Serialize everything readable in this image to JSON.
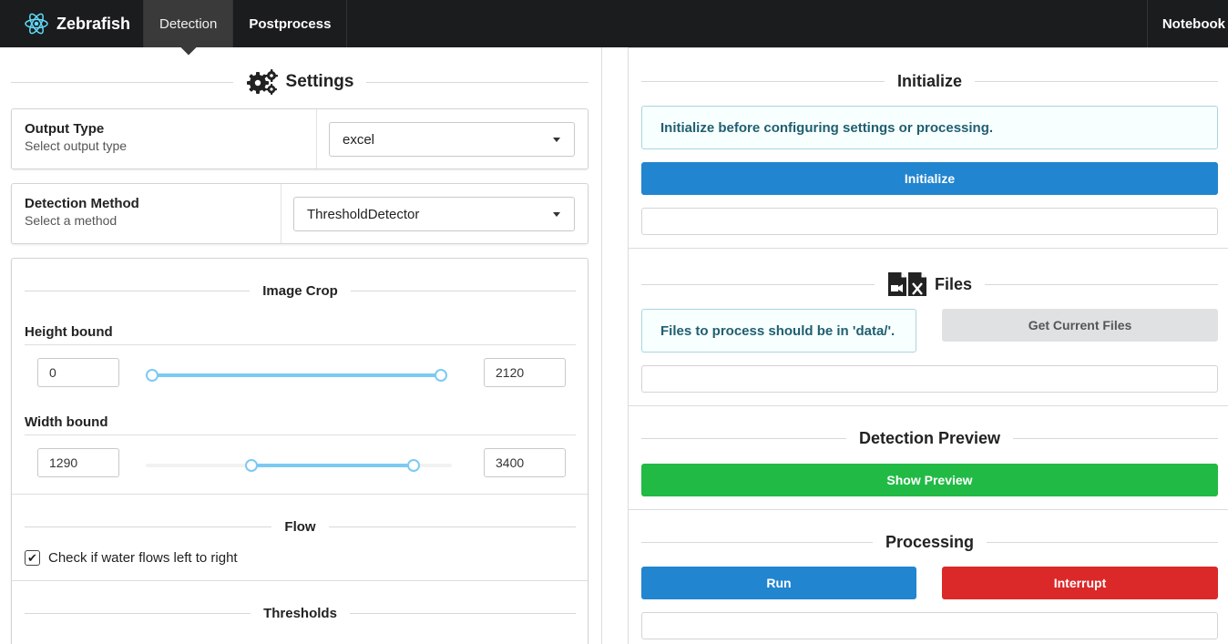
{
  "navbar": {
    "brand": "Zebrafish",
    "tabs": [
      {
        "label": "Detection"
      },
      {
        "label": "Postprocess"
      }
    ],
    "right_item": "Notebook"
  },
  "settings": {
    "title": "Settings",
    "output_type": {
      "label": "Output Type",
      "sublabel": "Select output type",
      "value": "excel"
    },
    "detection_method": {
      "label": "Detection Method",
      "sublabel": "Select a method",
      "value": "ThresholdDetector"
    },
    "image_crop": {
      "title": "Image Crop",
      "height_bound": {
        "label": "Height bound",
        "min": "0",
        "max": "2120",
        "low_fraction": 0.0,
        "high_fraction": 1.0
      },
      "width_bound": {
        "label": "Width bound",
        "min": "1290",
        "max": "3400",
        "low_fraction": 0.34,
        "high_fraction": 0.89
      }
    },
    "flow": {
      "title": "Flow",
      "checkbox_label": "Check if water flows left to right",
      "checked": true
    },
    "thresholds": {
      "title": "Thresholds"
    }
  },
  "initialize": {
    "title": "Initialize",
    "message": "Initialize before configuring settings or processing.",
    "button": "Initialize"
  },
  "files": {
    "title": "Files",
    "message": "Files to process should be in 'data/'.",
    "button": "Get Current Files"
  },
  "preview": {
    "title": "Detection Preview",
    "button": "Show Preview"
  },
  "processing": {
    "title": "Processing",
    "run_button": "Run",
    "interrupt_button": "Interrupt"
  },
  "colors": {
    "navbar": "#1b1c1d",
    "primary": "#2185d0",
    "positive": "#21ba45",
    "negative": "#db2828",
    "slider": "#7ccaf2",
    "info_text": "#1f5f70"
  },
  "icons": {
    "brand": "react-atom-icon",
    "settings": "cogs-icon",
    "files": "file-video-excel-icon",
    "dropdown": "caret-down-icon",
    "checkbox": "checkmark-icon"
  }
}
